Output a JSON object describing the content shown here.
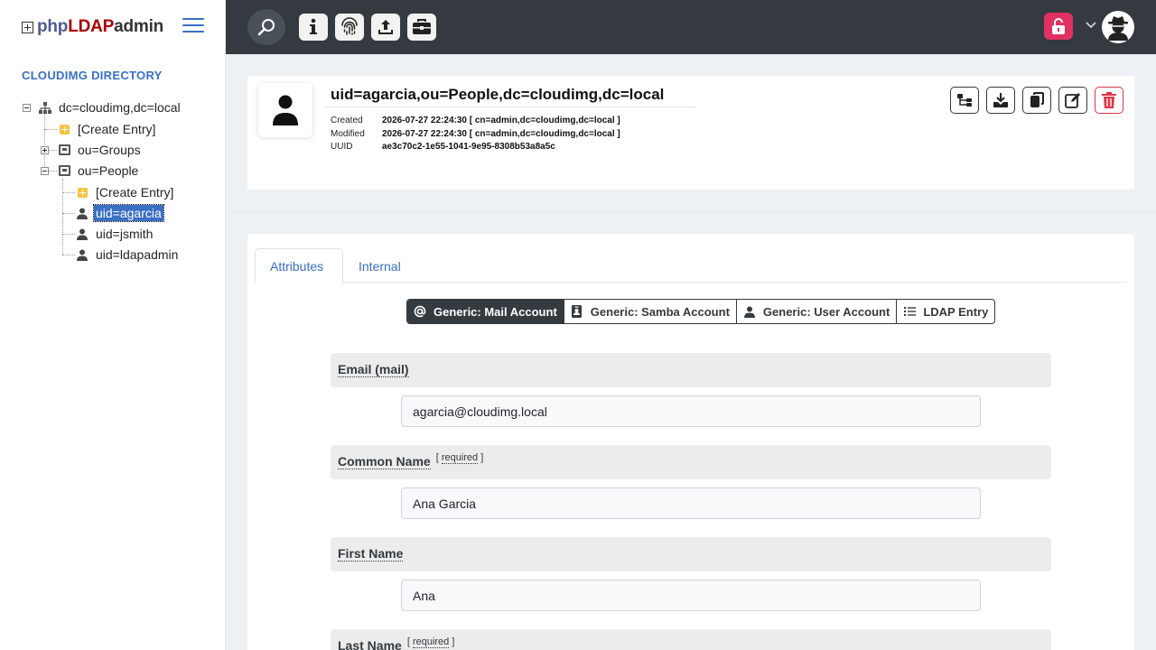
{
  "brand": {
    "php": "php",
    "ldap": "LDAP",
    "admin": "admin"
  },
  "sidebar": {
    "directory_title": "CLOUDIMG DIRECTORY",
    "tree": {
      "root": "dc=cloudimg,dc=local",
      "create_entry": "[Create Entry]",
      "groups": "ou=Groups",
      "people": "ou=People",
      "people_create_entry": "[Create Entry]",
      "users": [
        "uid=agarcia",
        "uid=jsmith",
        "uid=ldapadmin"
      ]
    }
  },
  "entry": {
    "dn": "uid=agarcia,ou=People,dc=cloudimg,dc=local",
    "created_label": "Created",
    "created_value": "2026-07-27 22:24:30 [ cn=admin,dc=cloudimg,dc=local ]",
    "modified_label": "Modified",
    "modified_value": "2026-07-27 22:24:30 [ cn=admin,dc=cloudimg,dc=local ]",
    "uuid_label": "UUID",
    "uuid_value": "ae3c70c2-1e55-1041-9e95-8308b53a8a5c"
  },
  "tabs": {
    "attributes": "Attributes",
    "internal": "Internal"
  },
  "templates": [
    "Generic: Mail Account",
    "Generic: Samba Account",
    "Generic: User Account",
    "LDAP Entry"
  ],
  "required_text": "required",
  "attributes": [
    {
      "name": "Email (mail)",
      "value": "agarcia@cloudimg.local",
      "required": false
    },
    {
      "name": "Common Name",
      "value": "Ana Garcia",
      "required": true
    },
    {
      "name": "First Name",
      "value": "Ana",
      "required": false
    },
    {
      "name": "Last Name",
      "value": "",
      "required": true
    }
  ],
  "colors": {
    "topbar": "#343a40",
    "accent": "#3a6fc4",
    "danger": "#dc3545",
    "lock": "#e03162"
  }
}
